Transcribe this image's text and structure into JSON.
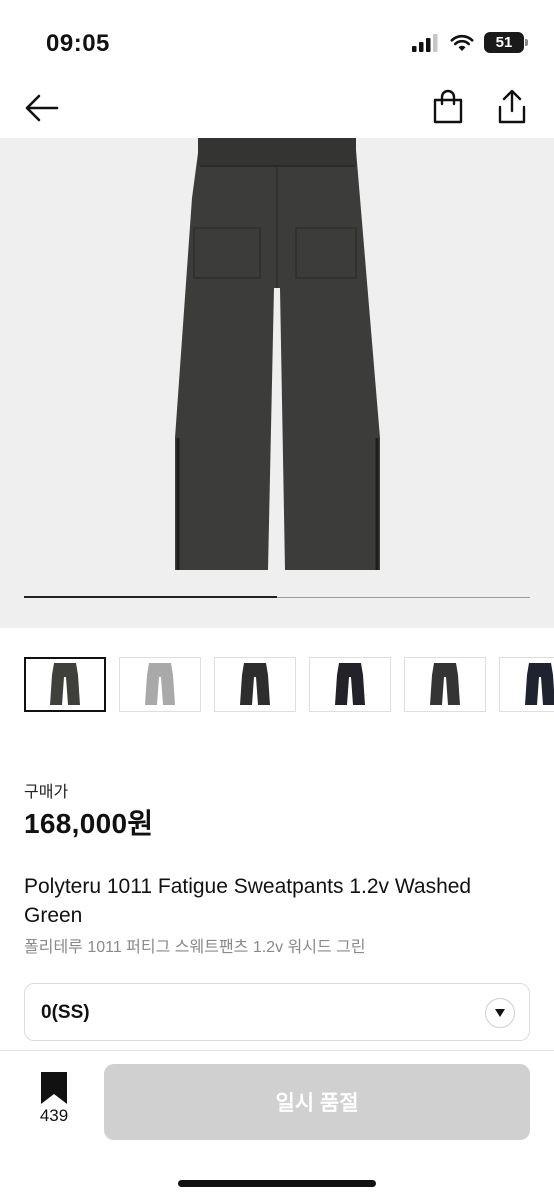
{
  "status_bar": {
    "time": "09:05",
    "battery": "51"
  },
  "product": {
    "price_label": "구매가",
    "price": "168,000원",
    "name_en": "Polyteru 1011 Fatigue Sweatpants 1.2v Washed Green",
    "name_ko": "폴리테루 1011 퍼티그 스웨트팬츠 1.2v 워시드 그린"
  },
  "gallery": {
    "progress": 0.5,
    "thumbnails": [
      {
        "color": "#3f3f3c",
        "selected": true
      },
      {
        "color": "#a9a9a9",
        "selected": false
      },
      {
        "color": "#2d2d2d",
        "selected": false
      },
      {
        "color": "#222228",
        "selected": false
      },
      {
        "color": "#343434",
        "selected": false
      },
      {
        "color": "#1f2330",
        "selected": false
      }
    ]
  },
  "size_select": {
    "value": "0(SS)"
  },
  "bottom_bar": {
    "bookmark_count": "439",
    "action_label": "일시 품절"
  },
  "colors": {
    "main_product": "#3c3d3a",
    "disabled_button": "#d0d0d0"
  }
}
